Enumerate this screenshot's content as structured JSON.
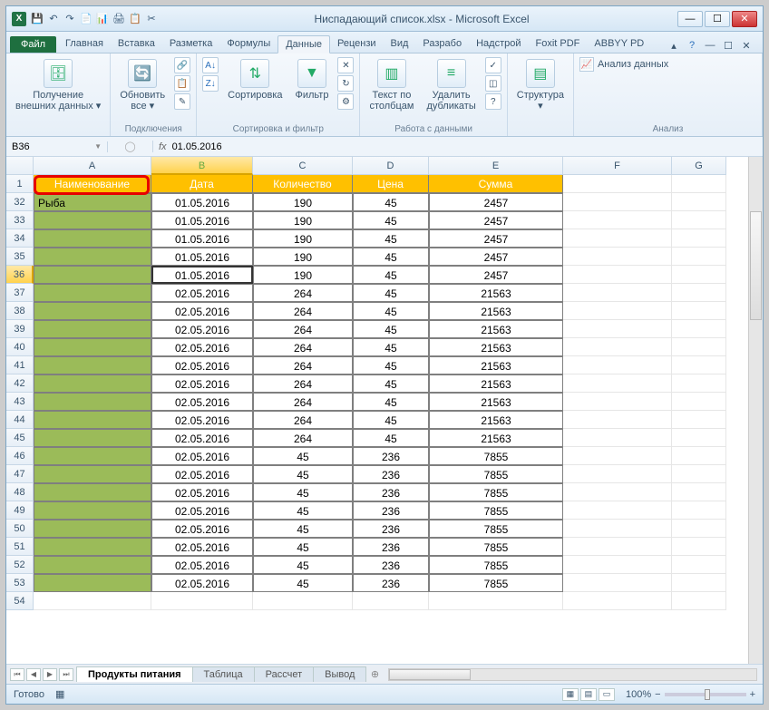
{
  "window": {
    "title": "Ниспадающий список.xlsx - Microsoft Excel"
  },
  "qat": [
    "💾",
    "↶",
    "↷",
    "📄",
    "📊",
    "🖨",
    "📋",
    "✂"
  ],
  "tabs": {
    "file": "Файл",
    "items": [
      "Главная",
      "Вставка",
      "Разметка",
      "Формулы",
      "Данные",
      "Рецензи",
      "Вид",
      "Разрабо",
      "Надстрой",
      "Foxit PDF",
      "ABBYY PD"
    ],
    "active": "Данные"
  },
  "ribbon": {
    "ext_data": "Получение\nвнешних данных ▾",
    "refresh": "Обновить\nвсе ▾",
    "connections": "Подключения",
    "sort": "Сортировка",
    "filter": "Фильтр",
    "sortfilter": "Сортировка и фильтр",
    "text_cols": "Текст по\nстолбцам",
    "dedup": "Удалить\nдубликаты",
    "datawork": "Работа с данными",
    "structure": "Структура\n▾",
    "analysis_btn": "Анализ данных",
    "analysis": "Анализ"
  },
  "namebox": "B36",
  "formula": "01.05.2016",
  "columns": [
    "A",
    "B",
    "C",
    "D",
    "E",
    "F",
    "G"
  ],
  "headers": [
    "Наименование",
    "Дата",
    "Количество",
    "Цена",
    "Сумма"
  ],
  "special_cell": "Рыба",
  "rows": [
    {
      "n": 32,
      "b": "01.05.2016",
      "c": "190",
      "d": "45",
      "e": "2457"
    },
    {
      "n": 33,
      "b": "01.05.2016",
      "c": "190",
      "d": "45",
      "e": "2457"
    },
    {
      "n": 34,
      "b": "01.05.2016",
      "c": "190",
      "d": "45",
      "e": "2457"
    },
    {
      "n": 35,
      "b": "01.05.2016",
      "c": "190",
      "d": "45",
      "e": "2457"
    },
    {
      "n": 36,
      "b": "01.05.2016",
      "c": "190",
      "d": "45",
      "e": "2457"
    },
    {
      "n": 37,
      "b": "02.05.2016",
      "c": "264",
      "d": "45",
      "e": "21563"
    },
    {
      "n": 38,
      "b": "02.05.2016",
      "c": "264",
      "d": "45",
      "e": "21563"
    },
    {
      "n": 39,
      "b": "02.05.2016",
      "c": "264",
      "d": "45",
      "e": "21563"
    },
    {
      "n": 40,
      "b": "02.05.2016",
      "c": "264",
      "d": "45",
      "e": "21563"
    },
    {
      "n": 41,
      "b": "02.05.2016",
      "c": "264",
      "d": "45",
      "e": "21563"
    },
    {
      "n": 42,
      "b": "02.05.2016",
      "c": "264",
      "d": "45",
      "e": "21563"
    },
    {
      "n": 43,
      "b": "02.05.2016",
      "c": "264",
      "d": "45",
      "e": "21563"
    },
    {
      "n": 44,
      "b": "02.05.2016",
      "c": "264",
      "d": "45",
      "e": "21563"
    },
    {
      "n": 45,
      "b": "02.05.2016",
      "c": "264",
      "d": "45",
      "e": "21563"
    },
    {
      "n": 46,
      "b": "02.05.2016",
      "c": "45",
      "d": "236",
      "e": "7855"
    },
    {
      "n": 47,
      "b": "02.05.2016",
      "c": "45",
      "d": "236",
      "e": "7855"
    },
    {
      "n": 48,
      "b": "02.05.2016",
      "c": "45",
      "d": "236",
      "e": "7855"
    },
    {
      "n": 49,
      "b": "02.05.2016",
      "c": "45",
      "d": "236",
      "e": "7855"
    },
    {
      "n": 50,
      "b": "02.05.2016",
      "c": "45",
      "d": "236",
      "e": "7855"
    },
    {
      "n": 51,
      "b": "02.05.2016",
      "c": "45",
      "d": "236",
      "e": "7855"
    },
    {
      "n": 52,
      "b": "02.05.2016",
      "c": "45",
      "d": "236",
      "e": "7855"
    },
    {
      "n": 53,
      "b": "02.05.2016",
      "c": "45",
      "d": "236",
      "e": "7855"
    }
  ],
  "empty_row": 54,
  "sheets": {
    "active": "Продукты питания",
    "others": [
      "Таблица",
      "Рассчет",
      "Вывод"
    ]
  },
  "status": "Готово",
  "zoom": "100%"
}
